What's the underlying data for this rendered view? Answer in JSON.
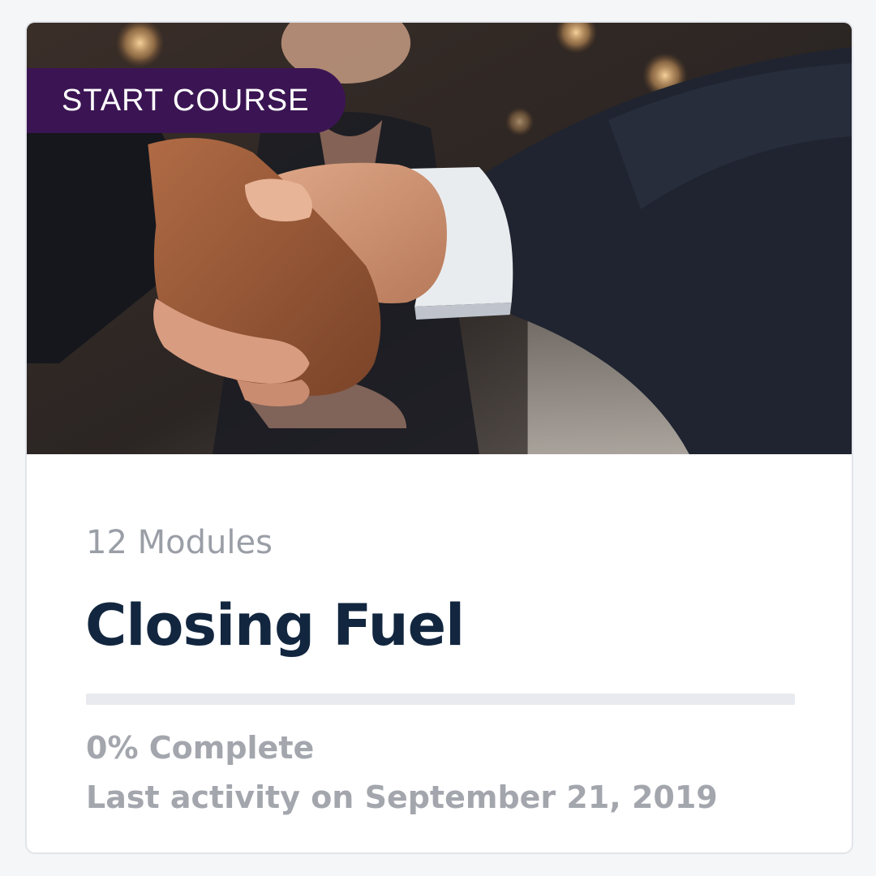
{
  "course_card": {
    "badge_label": "START COURSE",
    "modules_label": "12 Modules",
    "title": "Closing Fuel",
    "progress_fraction": 0,
    "complete_label": "0% Complete",
    "last_activity": "Last activity on September 21, 2019",
    "image_subject": "handshake-photo"
  },
  "colors": {
    "badge_bg": "#3b1553",
    "title": "#12263f",
    "muted_text": "#a3a6ad",
    "progress_track": "#e9eaef"
  }
}
